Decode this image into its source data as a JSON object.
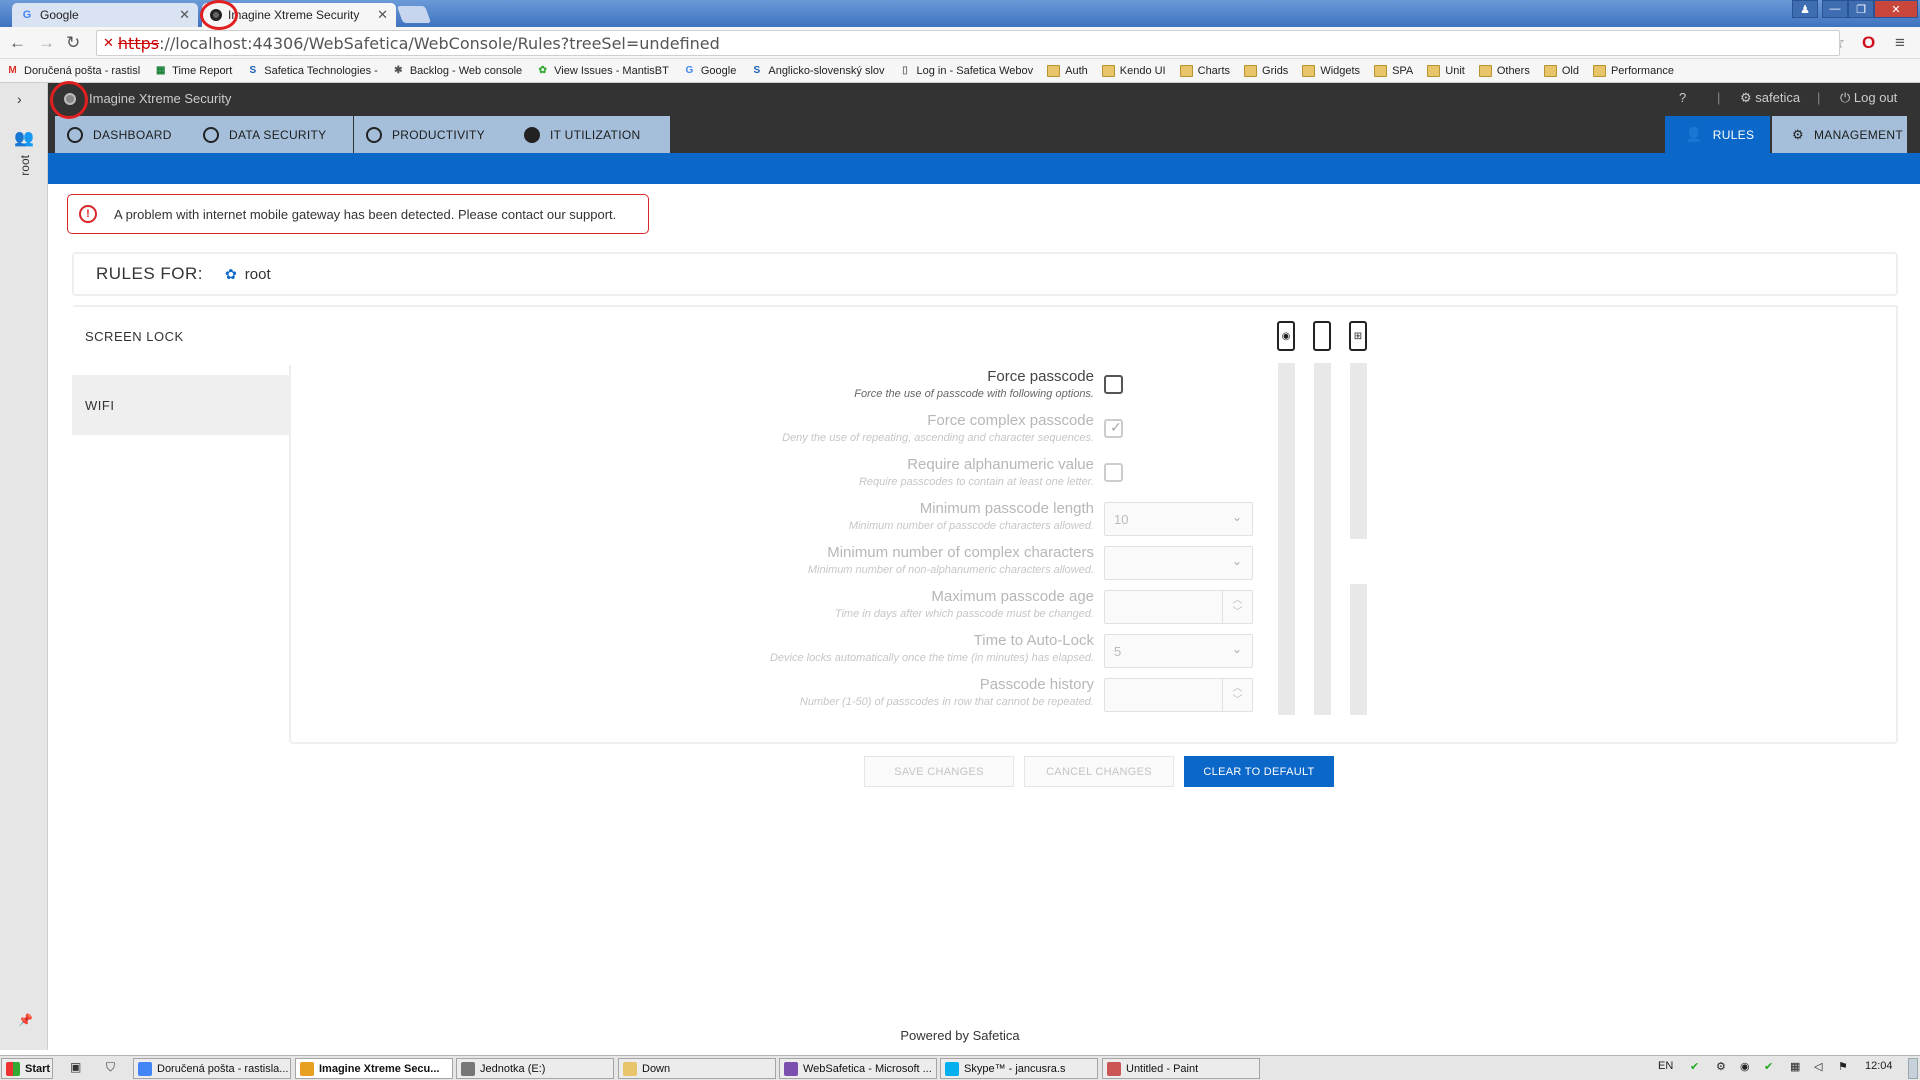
{
  "browser": {
    "tabs": [
      {
        "title": "Google",
        "active": false
      },
      {
        "title": "Imagine Xtreme Security",
        "active": true
      }
    ],
    "url_scheme": "https",
    "url_rest": "://localhost:44306/WebSafetica/WebConsole/Rules?treeSel=undefined",
    "bookmarks": [
      {
        "label": "Doručená pošta - rastisl",
        "icon": "gmail-icon"
      },
      {
        "label": "Time Report",
        "icon": "sheet-icon"
      },
      {
        "label": "Safetica Technologies -",
        "icon": "safetica-icon"
      },
      {
        "label": "Backlog - Web console",
        "icon": "bug-icon"
      },
      {
        "label": "View Issues - MantisBT",
        "icon": "mantis-icon"
      },
      {
        "label": "Google",
        "icon": "google-icon"
      },
      {
        "label": "Anglicko-slovenský slov",
        "icon": "s-icon"
      },
      {
        "label": "Log in - Safetica Webov",
        "icon": "page-icon"
      },
      {
        "label": "Auth",
        "icon": "folder-icon"
      },
      {
        "label": "Kendo UI",
        "icon": "folder-icon"
      },
      {
        "label": "Charts",
        "icon": "folder-icon"
      },
      {
        "label": "Grids",
        "icon": "folder-icon"
      },
      {
        "label": "Widgets",
        "icon": "folder-icon"
      },
      {
        "label": "SPA",
        "icon": "folder-icon"
      },
      {
        "label": "Unit",
        "icon": "folder-icon"
      },
      {
        "label": "Others",
        "icon": "folder-icon"
      },
      {
        "label": "Old",
        "icon": "folder-icon"
      },
      {
        "label": "Performance",
        "icon": "folder-icon"
      }
    ]
  },
  "app": {
    "title": "Imagine Xtreme Security",
    "user": "safetica",
    "logout": "Log out",
    "sidebar_user": "root",
    "nav_tabs": [
      "DASHBOARD",
      "DATA SECURITY",
      "PRODUCTIVITY",
      "IT UTILIZATION"
    ],
    "right_tabs": [
      "RULES",
      "MANAGEMENT"
    ],
    "alert": "A problem with internet mobile gateway has been detected. Please contact our support.",
    "rules_for_label": "RULES FOR:",
    "rules_for_value": "root",
    "side_tabs": [
      "SCREEN LOCK",
      "WIFI"
    ],
    "fields": [
      {
        "label": "Force passcode",
        "desc": "Force the use of passcode with following options.",
        "type": "checkbox",
        "checked": false,
        "disabled": false
      },
      {
        "label": "Force complex passcode",
        "desc": "Deny the use of repeating, ascending and character sequences.",
        "type": "checkbox",
        "checked": true,
        "disabled": true
      },
      {
        "label": "Require alphanumeric value",
        "desc": "Require passcodes to contain at least one letter.",
        "type": "checkbox",
        "checked": false,
        "disabled": true
      },
      {
        "label": "Minimum passcode length",
        "desc": "Minimum number of passcode characters allowed.",
        "type": "select",
        "value": "10",
        "disabled": true
      },
      {
        "label": "Minimum number of complex characters",
        "desc": "Minimum number of non-alphanumeric characters allowed.",
        "type": "select",
        "value": "",
        "disabled": true
      },
      {
        "label": "Maximum passcode age",
        "desc": "Time in days after which passcode must be changed.",
        "type": "spinner",
        "value": "",
        "disabled": true
      },
      {
        "label": "Time to Auto-Lock",
        "desc": "Device locks automatically once the time (in minutes) has elapsed.",
        "type": "select",
        "value": "5",
        "disabled": true
      },
      {
        "label": "Passcode history",
        "desc": "Number (1-50) of passcodes in row that cannot be repeated.",
        "type": "spinner",
        "value": "",
        "disabled": true
      }
    ],
    "device_icons": [
      "android-phone-icon",
      "apple-phone-icon",
      "windows-phone-icon"
    ],
    "buttons": {
      "save": "SAVE CHANGES",
      "cancel": "CANCEL CHANGES",
      "clear": "CLEAR TO DEFAULT"
    },
    "footer": "Powered by Safetica"
  },
  "taskbar": {
    "start": "Start",
    "tasks": [
      {
        "label": "Doručená pošta - rastisla...",
        "active": false
      },
      {
        "label": "Imagine Xtreme Secu...",
        "active": true
      },
      {
        "label": "Jednotka (E:)",
        "active": false
      },
      {
        "label": "Down",
        "active": false
      },
      {
        "label": "WebSafetica - Microsoft ...",
        "active": false
      },
      {
        "label": "Skype™ - jancusra.s",
        "active": false
      },
      {
        "label": "Untitled - Paint",
        "active": false
      }
    ],
    "lang": "EN",
    "clock": "12:04"
  },
  "colors": {
    "accent": "#0b67c8",
    "dark": "#333333",
    "navtab": "#a5bfdb",
    "alert": "#d9262a",
    "annotation": "#e02020"
  }
}
